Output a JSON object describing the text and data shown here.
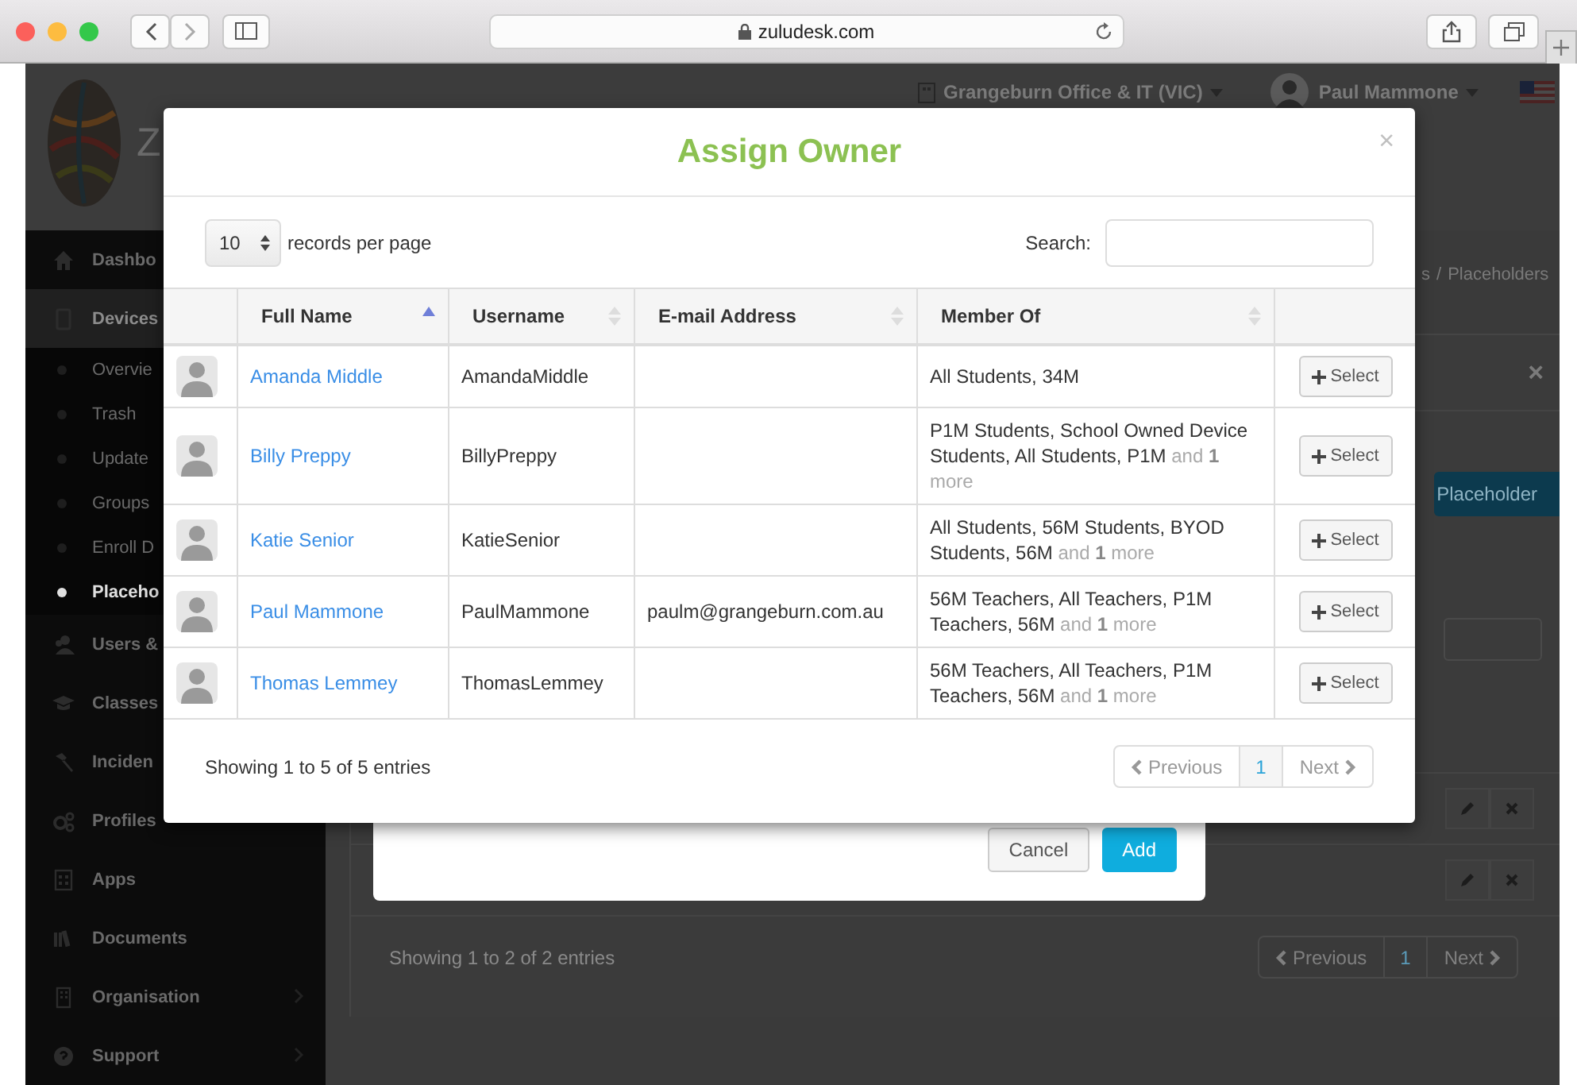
{
  "browser": {
    "url": "zuludesk.com"
  },
  "header": {
    "brand": "Z",
    "location": "Grangeburn Office & IT (VIC)",
    "user": "Paul Mammone"
  },
  "sidebar": {
    "items": [
      {
        "label": "Dashbo",
        "selected": false,
        "expandable": false
      },
      {
        "label": "Devices",
        "selected": true,
        "expandable": false,
        "expanded": true,
        "children": [
          {
            "label": "Overvie",
            "selected": false
          },
          {
            "label": "Trash",
            "selected": false
          },
          {
            "label": "Update",
            "selected": false
          },
          {
            "label": "Groups",
            "selected": false
          },
          {
            "label": "Enroll D",
            "selected": false
          },
          {
            "label": "Placeho",
            "selected": true
          }
        ]
      },
      {
        "label": "Users &",
        "selected": false,
        "expandable": false
      },
      {
        "label": "Classes",
        "selected": false,
        "expandable": false
      },
      {
        "label": "Inciden",
        "selected": false,
        "expandable": false
      },
      {
        "label": "Profiles",
        "selected": false,
        "expandable": false
      },
      {
        "label": "Apps",
        "selected": false,
        "expandable": false
      },
      {
        "label": "Documents",
        "selected": false,
        "expandable": false
      },
      {
        "label": "Organisation",
        "selected": false,
        "expandable": true
      },
      {
        "label": "Support",
        "selected": false,
        "expandable": true
      }
    ]
  },
  "breadcrumb": {
    "items": [
      "s",
      "Placeholders"
    ],
    "separator": "/"
  },
  "page": {
    "close": "×",
    "add_button": "Placeholder",
    "footer": "Showing 1 to 2 of 2 entries",
    "pagination": {
      "previous": {
        "label": "Previous",
        "disabled": true
      },
      "pages": [
        {
          "label": "1",
          "selected": true
        }
      ],
      "next": {
        "label": "Next",
        "disabled": true
      }
    }
  },
  "add_dialog": {
    "buttons": [
      {
        "label": "Cancel",
        "kind": "default"
      },
      {
        "label": "Add",
        "kind": "primary"
      }
    ]
  },
  "assign_dialog": {
    "title": "Assign Owner",
    "close": "×",
    "page_size": "10",
    "page_size_label": "records per page",
    "search_label": "Search:",
    "columns": [
      {
        "label": "Full Name",
        "sorted": true
      },
      {
        "label": "Username",
        "sorted": false
      },
      {
        "label": "E-mail Address",
        "sorted": false
      },
      {
        "label": "Member Of",
        "sorted": false
      }
    ],
    "rows": [
      {
        "name": "Amanda Middle",
        "username": "AmandaMiddle",
        "member_of": "All Students, 34M",
        "select": "Select"
      },
      {
        "name": "Billy Preppy",
        "username": "BillyPreppy",
        "member_of": "P1M Students, School Owned Device Students, All Students, P1M",
        "more": "and **1** more",
        "select": "Select"
      },
      {
        "name": "Katie Senior",
        "username": "KatieSenior",
        "member_of": "All Students, 56M Students, BYOD Students, 56M",
        "more": "and **1** more",
        "select": "Select"
      },
      {
        "name": "Paul Mammone",
        "username": "PaulMammone",
        "email": "paulm@grangeburn.com.au",
        "member_of": "56M Teachers, All Teachers, P1M Teachers, 56M",
        "more": "and **1** more",
        "select": "Select"
      },
      {
        "name": "Thomas Lemmey",
        "username": "ThomasLemmey",
        "member_of": "56M Teachers, All Teachers, P1M Teachers, 56M",
        "more": "and **1** more",
        "select": "Select"
      }
    ],
    "footer": "Showing 1 to 5 of 5 entries",
    "pagination": {
      "previous": {
        "label": "Previous",
        "disabled": true
      },
      "pages": [
        {
          "label": "1",
          "selected": true
        }
      ],
      "next": {
        "label": "Next",
        "disabled": true
      }
    }
  }
}
